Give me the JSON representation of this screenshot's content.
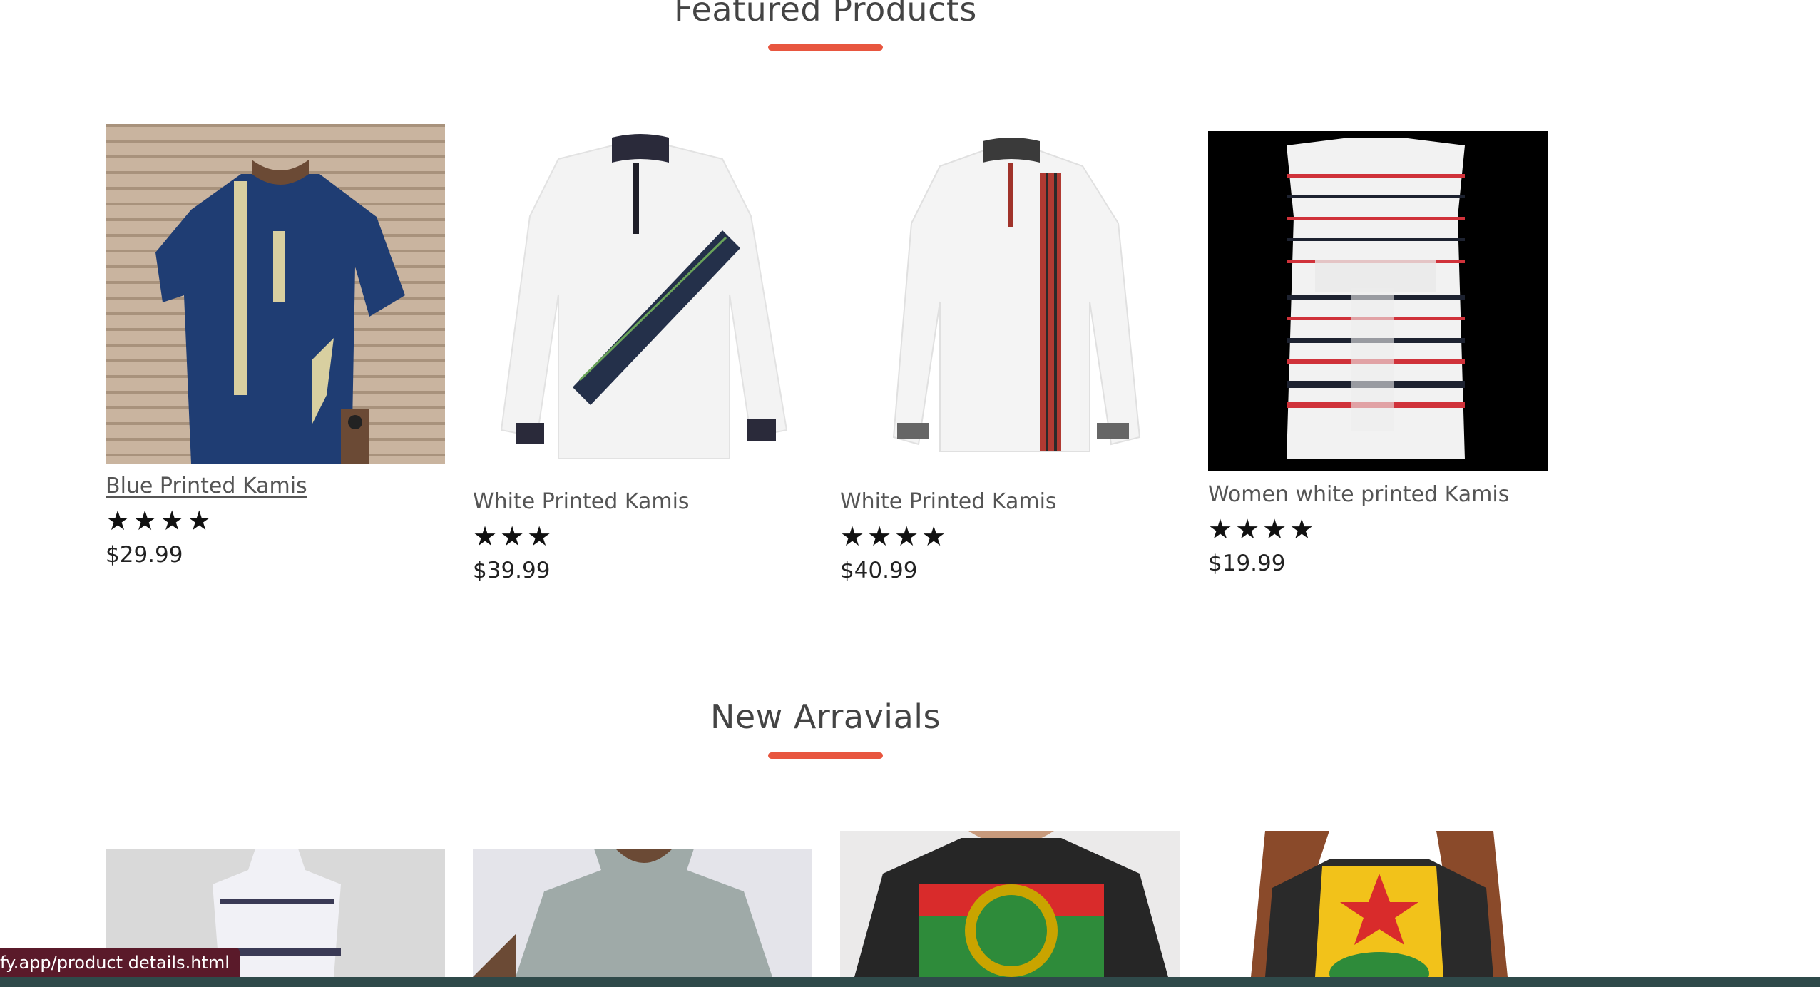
{
  "featured": {
    "title": "Featured Products",
    "accent_color": "#e8563f",
    "products": [
      {
        "name": "Blue Printed Kamis",
        "rating": 4,
        "stars": "★★★★",
        "price": "$29.99",
        "image": "blue-kamis-photo"
      },
      {
        "name": "White Printed Kamis",
        "rating": 3,
        "stars": "★★★",
        "price": "$39.99",
        "image": "white-kamis-diagonal-stripe-photo"
      },
      {
        "name": "White Printed Kamis",
        "rating": 4,
        "stars": "★★★★",
        "price": "$40.99",
        "image": "white-kamis-vertical-stripe-photo"
      },
      {
        "name": "Women white printed Kamis",
        "rating": 4,
        "stars": "★★★★",
        "price": "$19.99",
        "image": "women-striped-dress-photo"
      }
    ]
  },
  "new_arrivals": {
    "title": "New Arravials",
    "products": [
      {
        "image": "white-dress-mannequin-photo"
      },
      {
        "image": "grey-linen-top-photo"
      },
      {
        "image": "oromo-flag-tshirt-photo"
      },
      {
        "image": "raglan-tshirt-photo"
      }
    ]
  },
  "status_bar": {
    "url": "fy.app/product details.html"
  }
}
